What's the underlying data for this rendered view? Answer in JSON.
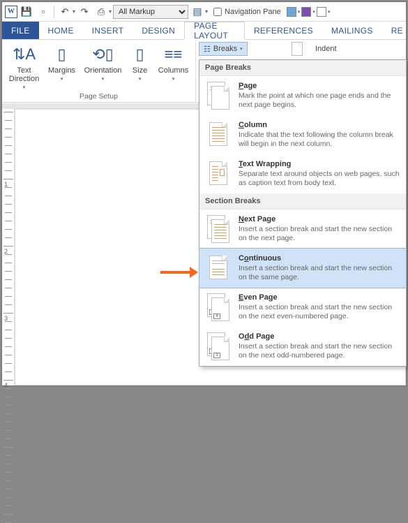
{
  "quick_access": {
    "markup_value": "All Markup",
    "nav_pane_label": "Navigation Pane",
    "nav_pane_checked": false
  },
  "tabs": {
    "file": "FILE",
    "home": "HOME",
    "insert": "INSERT",
    "design": "DESIGN",
    "page_layout": "PAGE LAYOUT",
    "references": "REFERENCES",
    "mailings": "MAILINGS",
    "review_partial": "RE"
  },
  "ribbon": {
    "text_direction": "Text\nDirection",
    "margins": "Margins",
    "orientation": "Orientation",
    "size": "Size",
    "columns": "Columns",
    "group_label": "Page Setup",
    "breaks_label": "Breaks",
    "indent_label": "Indent"
  },
  "dropdown": {
    "section1": "Page Breaks",
    "section2": "Section Breaks",
    "items": [
      {
        "title_pre": "",
        "title_u": "P",
        "title_post": "age",
        "desc": "Mark the point at which one page ends and the next page begins."
      },
      {
        "title_pre": "",
        "title_u": "C",
        "title_post": "olumn",
        "desc": "Indicate that the text following the column break will begin in the next column."
      },
      {
        "title_pre": "",
        "title_u": "T",
        "title_post": "ext Wrapping",
        "desc": "Separate text around objects on web pages, such as caption text from body text."
      },
      {
        "title_pre": "",
        "title_u": "N",
        "title_post": "ext Page",
        "desc": "Insert a section break and start the new section on the next page."
      },
      {
        "title_pre": "C",
        "title_u": "o",
        "title_post": "ntinuous",
        "desc": "Insert a section break and start the new section on the same page."
      },
      {
        "title_pre": "",
        "title_u": "E",
        "title_post": "ven Page",
        "desc": "Insert a section break and start the new section on the next even-numbered page."
      },
      {
        "title_pre": "O",
        "title_u": "d",
        "title_post": "d Page",
        "desc": "Insert a section break and start the new section on the next odd-numbered page."
      }
    ]
  },
  "ruler": {
    "marks": [
      "1",
      "2",
      "3",
      "4"
    ]
  },
  "colors": {
    "accent": "#2b579a",
    "highlight": "#cfe2f7",
    "arrow": "#f36a1f"
  }
}
